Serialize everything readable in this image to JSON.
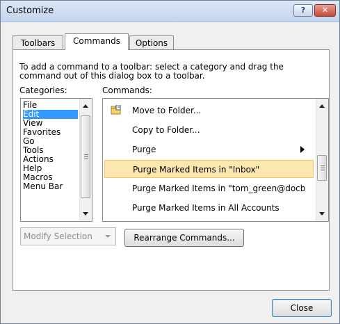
{
  "window": {
    "title": "Customize",
    "help_label": "?",
    "close_label": "✕"
  },
  "tabs": [
    {
      "label": "Toolbars"
    },
    {
      "label": "Commands"
    },
    {
      "label": "Options"
    }
  ],
  "instruction": "To add a command to a toolbar: select a category and drag the command out of this dialog box to a toolbar.",
  "categories": {
    "label": "Categories:",
    "items": [
      "File",
      "Edit",
      "View",
      "Favorites",
      "Go",
      "Tools",
      "Actions",
      "Help",
      "Macros",
      "Menu Bar"
    ],
    "selected": "Edit"
  },
  "commands": {
    "label": "Commands:",
    "items": [
      {
        "label": "Move to Folder...",
        "icon": "move-to-folder-icon"
      },
      {
        "label": "Copy to Folder..."
      },
      {
        "label": "Purge",
        "submenu": true
      },
      {
        "label": "Purge Marked Items in \"Inbox\"",
        "selected": true
      },
      {
        "label": "Purge Marked Items in \"tom_green@docb"
      },
      {
        "label": "Purge Marked Items in All Accounts"
      }
    ]
  },
  "modify_selection": {
    "label": "Modify Selection",
    "disabled": true
  },
  "buttons": {
    "rearrange": "Rearrange Commands...",
    "close": "Close"
  }
}
